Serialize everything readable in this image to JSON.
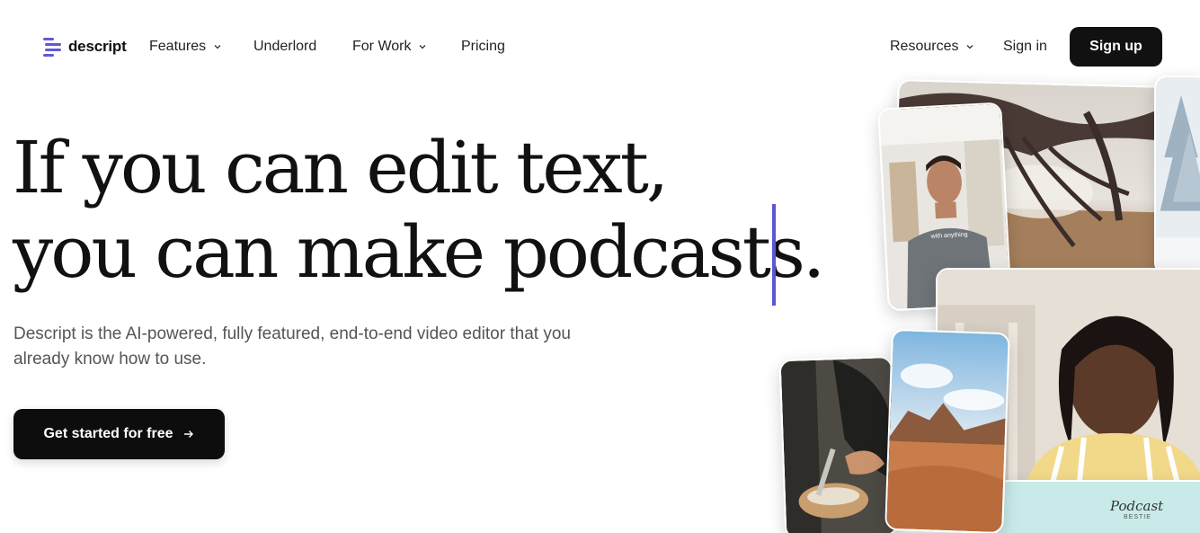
{
  "brand": {
    "name": "descript",
    "accent": "#5b55d8"
  },
  "nav": {
    "features": "Features",
    "underlord": "Underlord",
    "for_work": "For Work",
    "pricing": "Pricing",
    "resources": "Resources",
    "sign_in": "Sign in",
    "sign_up": "Sign up"
  },
  "hero": {
    "line1": "If you can edit text,",
    "line2": "you can make podcasts.",
    "subtitle": "Descript is the AI-powered, fully featured, end-to-end video editor that you already know how to use.",
    "cta": "Get started for free",
    "cta_icon": "arrow-right-icon"
  },
  "collage": {
    "shirt_caption": "with anything",
    "podcast_logo": "Podcast",
    "podcast_sub": "BESTIE"
  }
}
